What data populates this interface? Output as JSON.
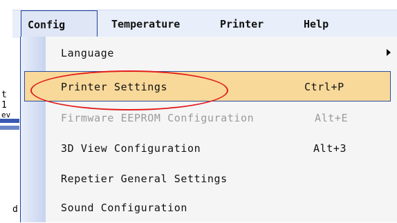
{
  "menubar": {
    "items": [
      {
        "label": "Config"
      },
      {
        "label": "Temperature"
      },
      {
        "label": "Printer"
      },
      {
        "label": "Help"
      }
    ]
  },
  "dropdown": {
    "items": [
      {
        "label": "Language",
        "shortcut": "",
        "submenu": true,
        "state": "normal"
      },
      {
        "label": "Printer Settings",
        "shortcut": "Ctrl+P",
        "submenu": false,
        "state": "highlighted"
      },
      {
        "label": "Firmware EEPROM Configuration",
        "shortcut": "Alt+E",
        "submenu": false,
        "state": "disabled"
      },
      {
        "label": "3D View Configuration",
        "shortcut": "Alt+3",
        "submenu": false,
        "state": "normal"
      },
      {
        "label": "Repetier General Settings",
        "shortcut": "",
        "submenu": false,
        "state": "normal"
      },
      {
        "label": "Sound Configuration",
        "shortcut": "",
        "submenu": false,
        "state": "normal"
      }
    ]
  },
  "background": {
    "fragments": [
      "t",
      "1",
      "ev",
      "d"
    ]
  },
  "colors": {
    "highlight_fill": "#f8d99a",
    "highlight_border": "#2b4f9f",
    "annotation_circle": "#e31b1b",
    "disabled_text": "#9a9a9a"
  }
}
